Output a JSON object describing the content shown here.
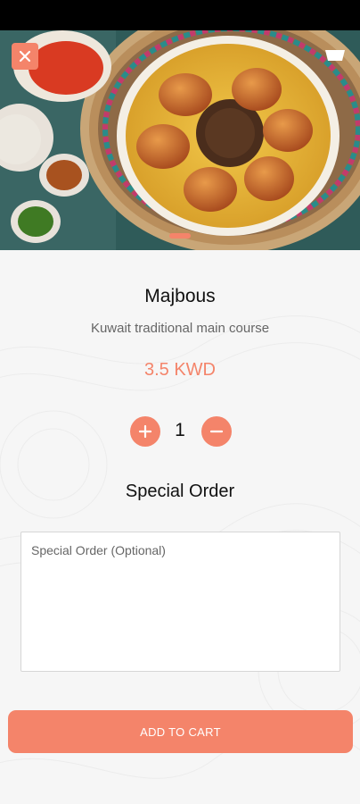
{
  "product": {
    "name": "Majbous",
    "description": "Kuwait traditional main course",
    "price": "3.5 KWD"
  },
  "quantity": {
    "value": "1",
    "increment_icon": "plus-icon",
    "decrement_icon": "minus-icon"
  },
  "special_order": {
    "title": "Special Order",
    "placeholder": "Special Order (Optional)",
    "value": ""
  },
  "actions": {
    "add_to_cart_label": "ADD TO CART"
  },
  "header": {
    "close_icon": "close-icon",
    "cart_icon": "cart-icon",
    "image_carousel": {
      "page": 1,
      "total": 1
    }
  },
  "colors": {
    "accent": "#f4846a",
    "background": "#f6f6f6",
    "text_primary": "#111111",
    "text_secondary": "#666666"
  }
}
